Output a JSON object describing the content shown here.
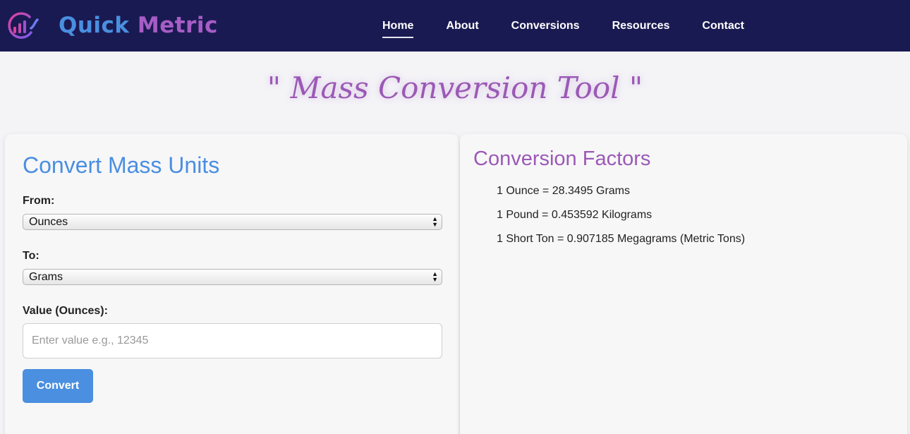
{
  "brand": {
    "word1": "Quick",
    "word2": "Metric",
    "colors": {
      "word1": "#4a8fe0",
      "word2": "#a65dc5"
    },
    "icon": "bar-chart-logo-icon"
  },
  "nav": {
    "items": [
      {
        "label": "Home",
        "active": true
      },
      {
        "label": "About"
      },
      {
        "label": "Conversions"
      },
      {
        "label": "Resources"
      },
      {
        "label": "Contact"
      }
    ],
    "background": "#1a1a52"
  },
  "page": {
    "title": "\" Mass Conversion Tool \"",
    "title_color": "#9b59b6"
  },
  "converter": {
    "heading": "Convert Mass Units",
    "from_label": "From:",
    "from_value": "Ounces",
    "to_label": "To:",
    "to_value": "Grams",
    "value_label": "Value (Ounces):",
    "value_placeholder": "Enter value e.g., 12345",
    "button_label": "Convert",
    "accent": "#4a8fe0"
  },
  "factors": {
    "heading": "Conversion Factors",
    "items": [
      "1 Ounce = 28.3495 Grams",
      "1 Pound = 0.453592 Kilograms",
      "1 Short Ton = 0.907185 Megagrams (Metric Tons)"
    ]
  }
}
